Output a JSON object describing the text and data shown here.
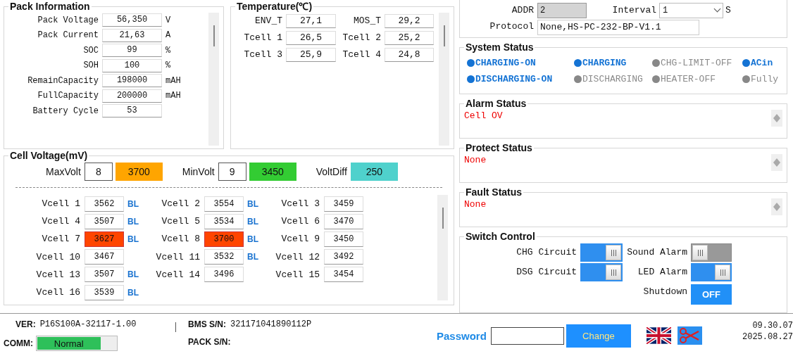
{
  "pack_information": {
    "title": "Pack Information",
    "rows": [
      {
        "label": "Pack Voltage",
        "value": "56,350",
        "unit": "V"
      },
      {
        "label": "Pack Current",
        "value": "21,63",
        "unit": "A"
      },
      {
        "label": "SOC",
        "value": "99",
        "unit": "%"
      },
      {
        "label": "SOH",
        "value": "100",
        "unit": "%"
      },
      {
        "label": "RemainCapacity",
        "value": "198000",
        "unit": "mAH"
      },
      {
        "label": "FullCapacity",
        "value": "200000",
        "unit": "mAH"
      },
      {
        "label": "Battery Cycle",
        "value": "53"
      }
    ]
  },
  "temperature": {
    "title": "Temperature(℃)",
    "sensors": [
      {
        "label": "ENV_T",
        "value": "27,1"
      },
      {
        "label": "MOS_T",
        "value": "29,2"
      },
      {
        "label": "Tcell 1",
        "value": "26,5"
      },
      {
        "label": "Tcell 2",
        "value": "25,2"
      },
      {
        "label": "Tcell 3",
        "value": "25,9"
      },
      {
        "label": "Tcell 4",
        "value": "24,8"
      }
    ]
  },
  "cell_voltage": {
    "title": "Cell Voltage(mV)",
    "summary": [
      {
        "label": "MaxVolt",
        "index": "8",
        "value": "3700",
        "color": "#ffa500"
      },
      {
        "label": "MinVolt",
        "index": "9",
        "value": "3450",
        "color": "#33cc33"
      },
      {
        "label": "VoltDiff",
        "value": "250",
        "color": "#4fd1cc"
      }
    ],
    "cells": [
      {
        "label": "Vcell 1",
        "value": "3562",
        "alert": false,
        "balance": "BL"
      },
      {
        "label": "Vcell 2",
        "value": "3554",
        "alert": false,
        "balance": "BL"
      },
      {
        "label": "Vcell 3",
        "value": "3459",
        "alert": false
      },
      {
        "label": "Vcell 4",
        "value": "3507",
        "alert": false,
        "balance": "BL"
      },
      {
        "label": "Vcell 5",
        "value": "3534",
        "alert": false,
        "balance": "BL"
      },
      {
        "label": "Vcell 6",
        "value": "3470",
        "alert": false
      },
      {
        "label": "Vcell 7",
        "value": "3627",
        "alert": true,
        "balance": "BL"
      },
      {
        "label": "Vcell 8",
        "value": "3700",
        "alert": true,
        "balance": "BL"
      },
      {
        "label": "Vcell 9",
        "value": "3450",
        "alert": false
      },
      {
        "label": "Vcell 10",
        "value": "3467",
        "alert": false
      },
      {
        "label": "Vcell 11",
        "value": "3532",
        "alert": false,
        "balance": "BL"
      },
      {
        "label": "Vcell 12",
        "value": "3492",
        "alert": false
      },
      {
        "label": "Vcell 13",
        "value": "3507",
        "alert": false,
        "balance": "BL"
      },
      {
        "label": "Vcell 14",
        "value": "3496",
        "alert": false
      },
      {
        "label": "Vcell 15",
        "value": "3454",
        "alert": false
      },
      {
        "label": "Vcell 16",
        "value": "3539",
        "alert": false,
        "balance": "BL"
      }
    ]
  },
  "connection": {
    "addr_label": "ADDR",
    "addr": "2",
    "interval_label": "Interval",
    "interval": "1",
    "interval_unit": "S",
    "protocol_label": "Protocol",
    "protocol": "None,HS-PC-232-BP-V1.1"
  },
  "system_status": {
    "title": "System Status",
    "items": [
      {
        "label": "CHARGING-ON",
        "on": true
      },
      {
        "label": "CHARGING",
        "on": true
      },
      {
        "label": "CHG-LIMIT-OFF",
        "on": false
      },
      {
        "label": "ACin",
        "on": true
      },
      {
        "label": "DISCHARGING-ON",
        "on": true
      },
      {
        "label": "DISCHARGING",
        "on": false
      },
      {
        "label": "HEATER-OFF",
        "on": false
      },
      {
        "label": "Fully",
        "on": false
      }
    ]
  },
  "status_boxes": [
    {
      "title": "Alarm Status",
      "text": "Cell OV"
    },
    {
      "title": "Protect Status",
      "text": "None"
    },
    {
      "title": "Fault Status",
      "text": "None"
    }
  ],
  "switch_control": {
    "title": "Switch Control",
    "switches": [
      {
        "kind": "toggle",
        "label": "CHG Circuit",
        "on": true
      },
      {
        "kind": "toggle",
        "label": "Sound Alarm",
        "on": false
      },
      {
        "kind": "toggle",
        "label": "DSG Circuit",
        "on": true
      },
      {
        "kind": "toggle",
        "label": "LED Alarm",
        "on": true
      },
      {
        "kind": "button",
        "label": "Shutdown",
        "button": "OFF"
      }
    ]
  },
  "footer": {
    "ver_label": "VER:",
    "ver": "P16S100A-32117-1.00",
    "comm_label": "COMM:",
    "comm": "Normal",
    "comm_level": {
      "level": 0.8
    },
    "bms_sn_label": "BMS S/N:",
    "bms_sn": "321171041890112P",
    "pack_sn_label": "PACK S/N:",
    "password_label": "Password",
    "change_button": "Change",
    "time": "09.30.07",
    "date": "2025.08.27"
  }
}
